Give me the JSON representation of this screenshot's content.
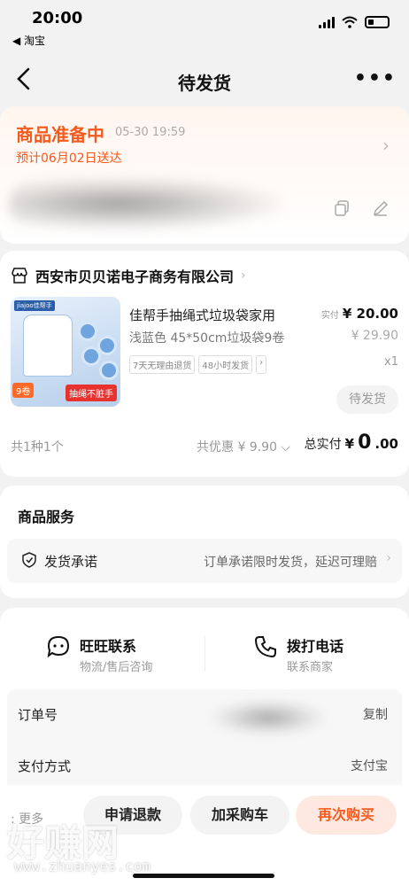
{
  "status_bar": {
    "time": "20:00",
    "back_app": "◀ 淘宝"
  },
  "nav": {
    "title": "待发货",
    "more": "•••"
  },
  "order_status": {
    "title": "商品准备中",
    "time": "05-30 19:59",
    "eta": "预计06月02日送达"
  },
  "shop": {
    "name": "西安市贝贝诺电子商务有限公司"
  },
  "product": {
    "title": "佳帮手抽绳式垃圾袋家用",
    "spec": "浅蓝色 45*50cm垃圾袋9卷",
    "price_label": "实付",
    "price": "¥ 20.00",
    "original_price": "¥ 29.90",
    "tags": [
      "7天无理由退货",
      "48小时发货",
      "›"
    ],
    "quantity": "x1",
    "status_button": "待发货",
    "image_texts": {
      "brand": "jiajoo佳帮手",
      "banner": "抽绳不脏手",
      "count": "9卷"
    }
  },
  "summary": {
    "count": "共1种1个",
    "discount": "共优惠 ¥ 9.90 ⌵",
    "total_label": "总实付",
    "total_currency": "¥",
    "total_int": "0",
    "total_dec": ".00"
  },
  "service": {
    "title": "商品服务",
    "label": "发货承诺",
    "desc": "订单承诺限时发货，延迟可理赔"
  },
  "contacts": [
    {
      "main": "旺旺联系",
      "sub": "物流/售后咨询"
    },
    {
      "main": "拨打电话",
      "sub": "联系商家"
    }
  ],
  "order_info": {
    "order_no_label": "订单号",
    "copy": "复制",
    "payment_label": "支付方式",
    "payment_value": "支付宝"
  },
  "bottom": {
    "more": "更多",
    "refund": "申请退款",
    "add_cart": "加采购车",
    "rebuy": "再次购买",
    "watermark": "好赚网",
    "watermark_url": "www.zhuanyes.com"
  },
  "colors": {
    "accent": "#f55a1e",
    "rebuy_bg": "#ffe8df"
  }
}
